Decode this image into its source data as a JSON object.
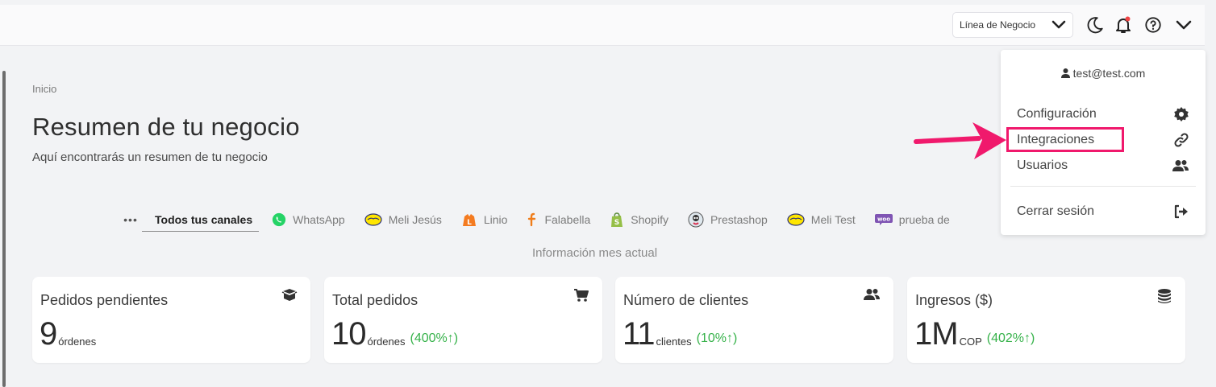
{
  "header": {
    "business_line": "Línea de Negocio"
  },
  "page": {
    "breadcrumb": "Inicio",
    "title": "Resumen de tu negocio",
    "subtitle": "Aquí encontrarás un resumen de tu negocio"
  },
  "channels": {
    "more": "•••",
    "items": [
      "Todos tus canales",
      "WhatsApp",
      "Meli Jesús",
      "Linio",
      "Falabella",
      "Shopify",
      "Prestashop",
      "Meli Test",
      "prueba de"
    ]
  },
  "month_info": "Información mes actual",
  "cards": [
    {
      "title": "Pedidos pendientes",
      "value": "9",
      "unit": "órdenes",
      "change": ""
    },
    {
      "title": "Total pedidos",
      "value": "10",
      "unit": "órdenes",
      "change": "(400%↑)"
    },
    {
      "title": "Número de clientes",
      "value": "11",
      "unit": "clientes",
      "change": "(10%↑)"
    },
    {
      "title": "Ingresos ($)",
      "value": "1M",
      "unit": "COP",
      "change": "(402%↑)"
    }
  ],
  "user_menu": {
    "email": "test@test.com",
    "items": [
      "Configuración",
      "Integraciones",
      "Usuarios",
      "Cerrar sesión"
    ]
  },
  "colors": {
    "positive": "#36b24a",
    "highlight": "#f0196c",
    "whatsapp": "#25d366",
    "linio": "#f47b20",
    "shopify": "#95bf47",
    "woo": "#7f54b3"
  }
}
